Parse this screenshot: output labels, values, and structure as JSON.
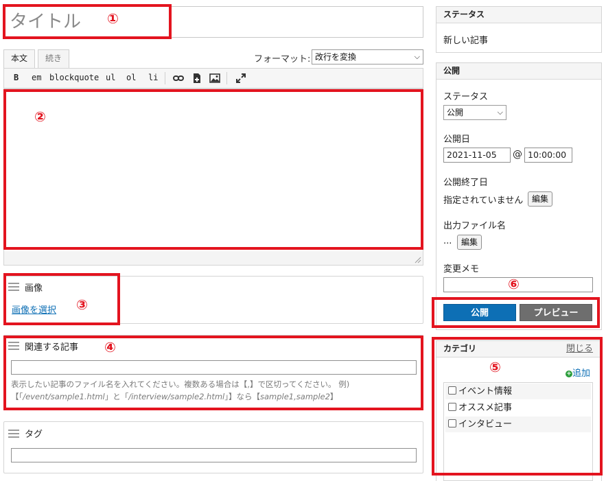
{
  "title_field": {
    "placeholder": "タイトル"
  },
  "editor": {
    "tabs": [
      {
        "label": "本文",
        "active": true
      },
      {
        "label": "続き",
        "active": false
      }
    ],
    "format_label": "フォーマット:",
    "format_value": "改行を変換",
    "toolbar": {
      "buttons": [
        "B",
        "em",
        "blockquote",
        "ul",
        "ol",
        "li"
      ],
      "icons": [
        "link-icon",
        "file-insert-icon",
        "image-icon",
        "fullscreen-icon"
      ]
    }
  },
  "image_box": {
    "title": "画像",
    "select_link": "画像を選択"
  },
  "related_box": {
    "title": "関連する記事",
    "input_value": "",
    "hint_line1": "表示したい記事のファイル名を入れてください。複数ある場合は【,】で区切ってください。 例)",
    "hint_line2_pre": "【「",
    "hint_path1": "/event/sample1.html",
    "hint_mid": "」と「",
    "hint_path2": "/interview/sample2.html",
    "hint_line2_post": "」】なら【",
    "hint_example": "sample1,sample2",
    "hint_end": "】"
  },
  "tag_box": {
    "title": "タグ",
    "input_value": ""
  },
  "status_box": {
    "header": "ステータス",
    "value": "新しい記事"
  },
  "publish_box": {
    "header": "公開",
    "status_label": "ステータス",
    "status_value": "公開",
    "date_label": "公開日",
    "date_value": "2021-11-05",
    "at_sign": "@",
    "time_value": "10:00:00",
    "end_label": "公開終了日",
    "end_value": "指定されていません",
    "edit_label": "編集",
    "filename_label": "出力ファイル名",
    "filename_value": "...",
    "memo_label": "変更メモ",
    "memo_value": "",
    "publish_button": "公開",
    "preview_button": "プレビュー"
  },
  "category_box": {
    "header": "カテゴリ",
    "close_link": "閉じる",
    "add_link": "追加",
    "items": [
      {
        "label": "イベント情報",
        "checked": false
      },
      {
        "label": "オススメ記事",
        "checked": false
      },
      {
        "label": "インタビュー",
        "checked": false
      }
    ]
  },
  "annotations": [
    "①",
    "②",
    "③",
    "④",
    "⑤",
    "⑥"
  ],
  "colors": {
    "annotation": "#e3141f",
    "publish": "#0d6fb5",
    "preview": "#6e6e6e",
    "link": "#0d6fb5",
    "add": "#2a9d3a"
  }
}
